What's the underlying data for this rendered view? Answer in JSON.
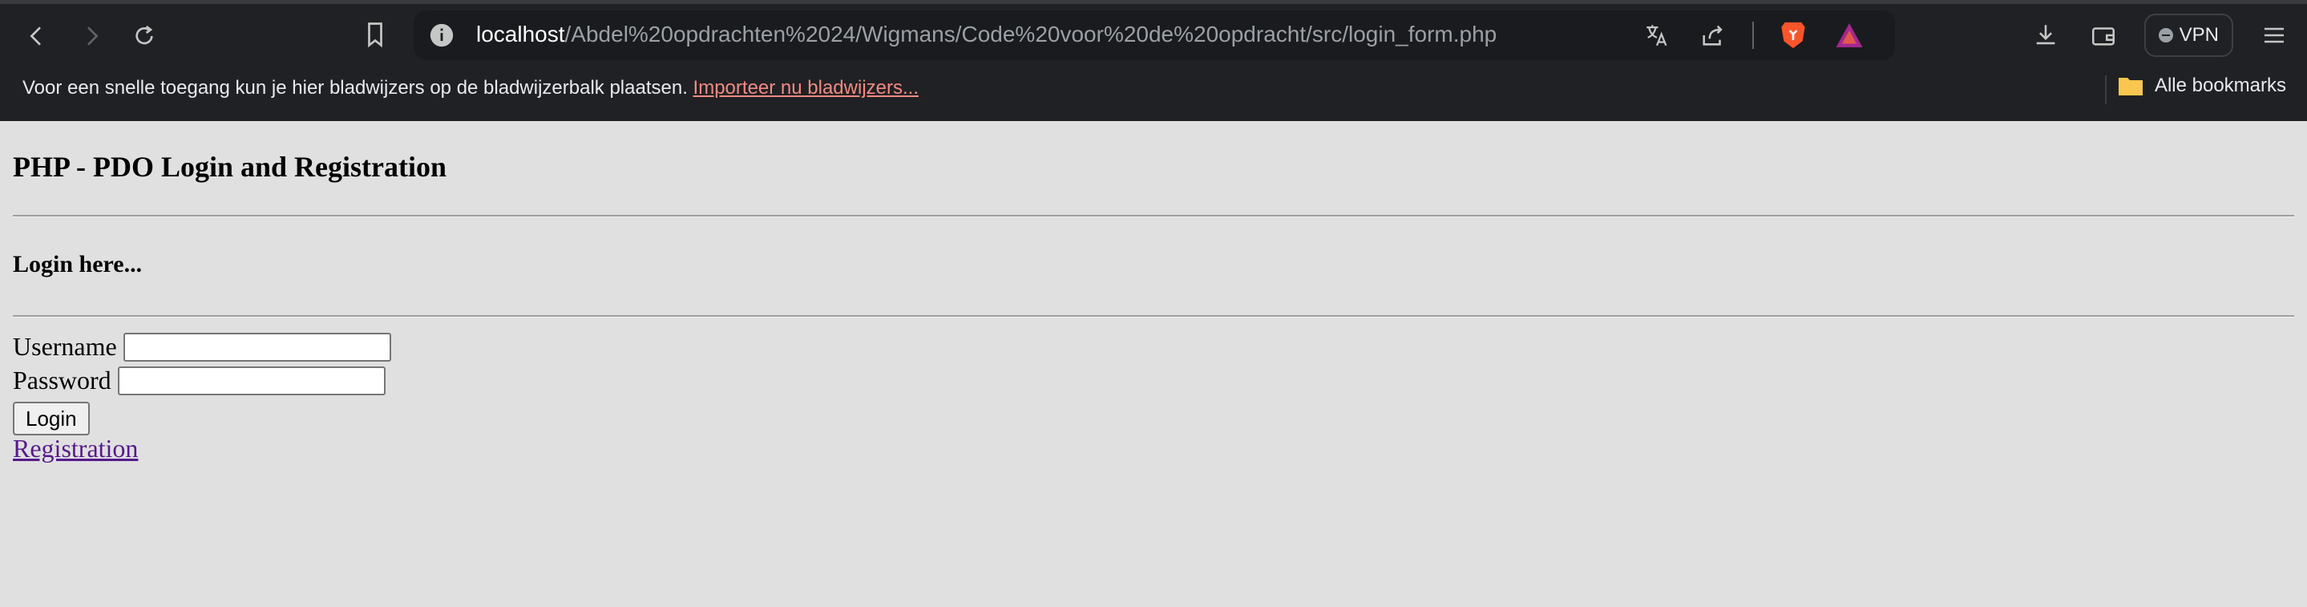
{
  "browser": {
    "url_host": "localhost",
    "url_path": "/Abdel%20opdrachten%2024/Wigmans/Code%20voor%20de%20opdracht/src/login_form.php",
    "vpn_label": "VPN",
    "bookmarks_bar_text": "Voor een snelle toegang kun je hier bladwijzers op de bladwijzerbalk plaatsen.",
    "bookmarks_bar_link": "Importeer nu bladwijzers...",
    "all_bookmarks": "Alle bookmarks",
    "icons": [
      "back-icon",
      "forward-icon",
      "reload-icon",
      "bookmark-icon",
      "info-icon",
      "translate-icon",
      "share-icon",
      "brave-shield-icon",
      "brave-rewards-icon",
      "download-icon",
      "wallet-icon",
      "menu-icon",
      "folder-icon"
    ]
  },
  "page": {
    "title": "PHP - PDO Login and Registration",
    "subtitle": "Login here...",
    "username_label": "Username",
    "password_label": "Password",
    "login_button": "Login",
    "registration_link": "Registration"
  }
}
